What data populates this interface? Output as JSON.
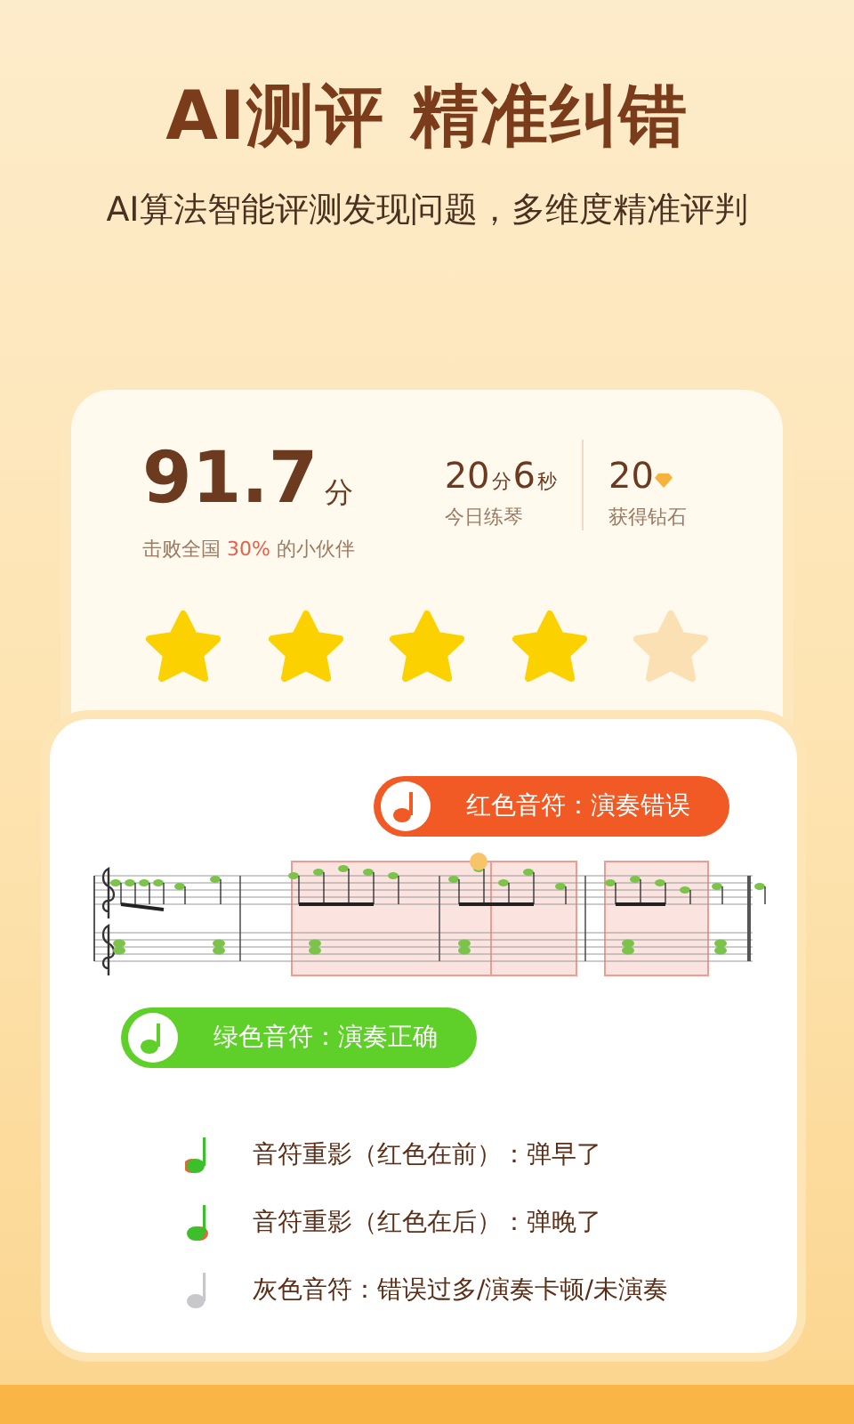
{
  "headline": "AI测评 精准纠错",
  "subtitle": "AI算法智能评测发现问题，多维度精准评判",
  "result": {
    "score": "91.7",
    "score_unit": "分",
    "beaten": "击败全国 **30%** 的小伙伴",
    "stats": [
      {
        "parts": [
          {
            "text": "20",
            "kind": "num"
          },
          {
            "text": "分",
            "kind": "unit"
          },
          {
            "text": "6",
            "kind": "num"
          },
          {
            "text": "秒",
            "kind": "unit"
          }
        ],
        "label": "今日练琴",
        "kind": "time"
      },
      {
        "parts": [
          {
            "text": "20",
            "kind": "num"
          }
        ],
        "label": "获得钻石",
        "kind": "diamond"
      }
    ],
    "stars": 4
  },
  "bubbles": [
    {
      "text": "红色音符：演奏错误",
      "kind": "wrong"
    },
    {
      "text": "绿色音符：演奏正确",
      "kind": "right"
    }
  ],
  "legend": [
    {
      "text": "音符重影（红色在前）：弹早了",
      "kind": "early"
    },
    {
      "text": "音符重影（红色在后）：弹晚了",
      "kind": "late"
    },
    {
      "text": "灰色音符：错误过多/演奏卡顿/未演奏",
      "kind": "gray"
    }
  ]
}
